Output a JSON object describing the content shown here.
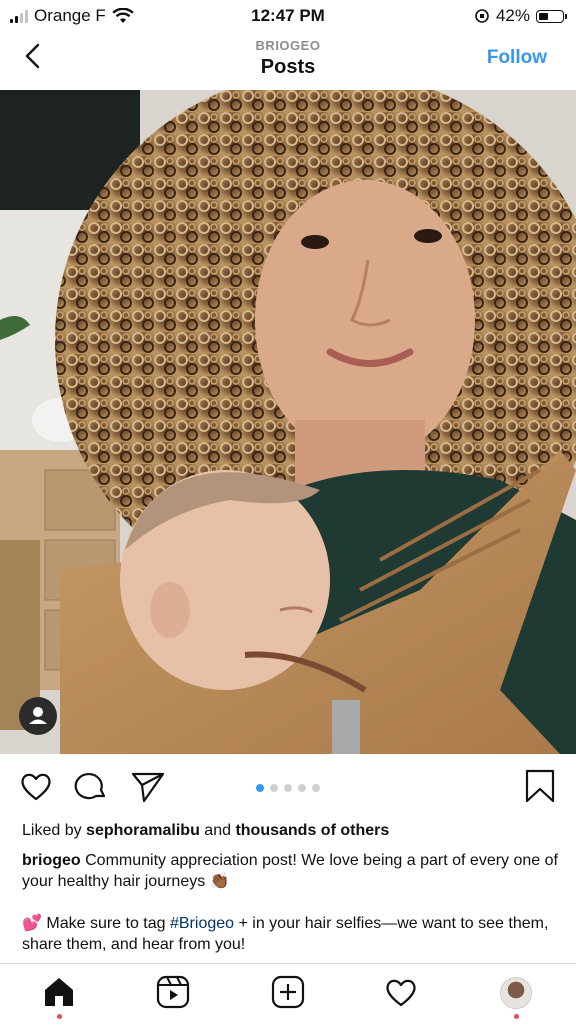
{
  "status_bar": {
    "carrier": "Orange F",
    "time": "12:47 PM",
    "battery": "42%",
    "battery_level": 0.42
  },
  "header": {
    "account": "BRIOGEO",
    "title": "Posts",
    "follow_label": "Follow"
  },
  "post": {
    "carousel": {
      "count": 5,
      "active_index": 0
    },
    "likes_prefix": "Liked by ",
    "likes_user": "sephoramalibu",
    "likes_middle": " and ",
    "likes_suffix": "thousands of others",
    "caption_user": "briogeo",
    "caption_text": " Community appreciation post! We love being a part of every one of your healthy hair journeys 👏🏾",
    "caption2_before": "💕 Make sure to tag ",
    "caption2_hashtag": "#Briogeo",
    "caption2_after": " + in your hair selfies—we want to see them, share them, and hear from you!"
  },
  "icons": {
    "back": "chevron-left-icon",
    "like": "heart-icon",
    "comment": "comment-bubble-icon",
    "share": "paper-plane-icon",
    "save": "bookmark-icon",
    "user_tag": "person-tag-icon",
    "tabs": [
      "home-icon",
      "reels-icon",
      "create-icon",
      "activity-heart-icon",
      "profile-avatar"
    ]
  },
  "colors": {
    "accent_blue": "#3797f0",
    "hashtag": "#00376b",
    "notification_dot": "#ed4956"
  }
}
